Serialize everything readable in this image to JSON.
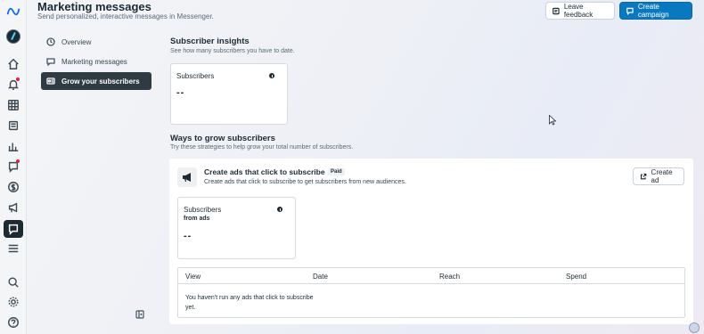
{
  "header": {
    "title": "Marketing messages",
    "subtitle": "Send personalized, interactive messages in Messenger.",
    "leave_feedback": "Leave feedback",
    "create_campaign": "Create campaign"
  },
  "sidebar_nav": {
    "items": [
      {
        "label": "Overview",
        "icon": "clock-icon"
      },
      {
        "label": "Marketing messages",
        "icon": "speech-bubble-icon"
      },
      {
        "label": "Grow your subscribers",
        "icon": "id-card-icon",
        "active": true
      }
    ]
  },
  "insights": {
    "title": "Subscriber insights",
    "subtitle": "See how many subscribers you have to date.",
    "card_label": "Subscribers",
    "card_value": "--"
  },
  "grow": {
    "title": "Ways to grow subscribers",
    "subtitle": "Try these strategies to help grow your total number of subscribers.",
    "ad_title": "Create ads that click to subscribe",
    "ad_badge": "Paid",
    "ad_description": "Create ads that click to subscribe to get subscribers from new audiences.",
    "create_ad": "Create ad",
    "card_label_line1": "Subscribers",
    "card_label_line2": "from ads",
    "card_value": "--",
    "table": {
      "columns": [
        "View",
        "Date",
        "Reach",
        "Spend"
      ],
      "empty_text": "You haven't run any ads that click to subscribe yet."
    }
  },
  "colors": {
    "primary": "#0a78be",
    "active_nav": "#2f3b43",
    "text": "#1c2b33"
  }
}
